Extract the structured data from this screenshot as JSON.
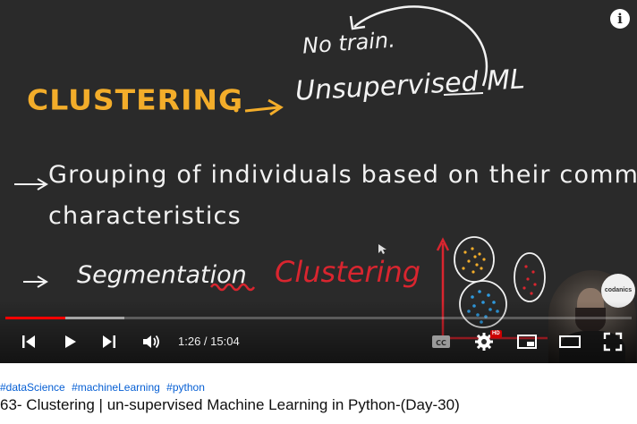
{
  "video": {
    "board": {
      "heading": "CLUSTERING",
      "annotation_no_training": "No train.",
      "annotation_unsupervised": "Unsupervised ML",
      "definition_line1": "Grouping of individuals based on their common",
      "definition_line2": "characteristics",
      "segmentation": "Segmentation",
      "clustering_red": "Clustering",
      "colors": {
        "heading": "#f3ad2a",
        "chalk": "#f2f2f2",
        "accent_red": "#d9252f",
        "board": "#2a2a2a"
      }
    },
    "channel_logo": "codanics",
    "info_icon": "info-icon"
  },
  "player": {
    "current_time": "1:26",
    "separator": " / ",
    "duration": "15:04",
    "played_fraction": 0.095,
    "buffered_fraction": 0.19,
    "hd_badge": "HD",
    "progress_color": "#ff0000",
    "icons": [
      "skip-previous-icon",
      "play-icon",
      "skip-next-icon",
      "volume-icon",
      "captions-icon",
      "settings-icon",
      "miniplayer-icon",
      "theater-mode-icon",
      "fullscreen-icon"
    ]
  },
  "below": {
    "hashtags": [
      "#dataScience",
      "#machineLearning",
      "#python"
    ],
    "title": "63- Clustering | un-supervised Machine Learning in Python-(Day-30)"
  }
}
